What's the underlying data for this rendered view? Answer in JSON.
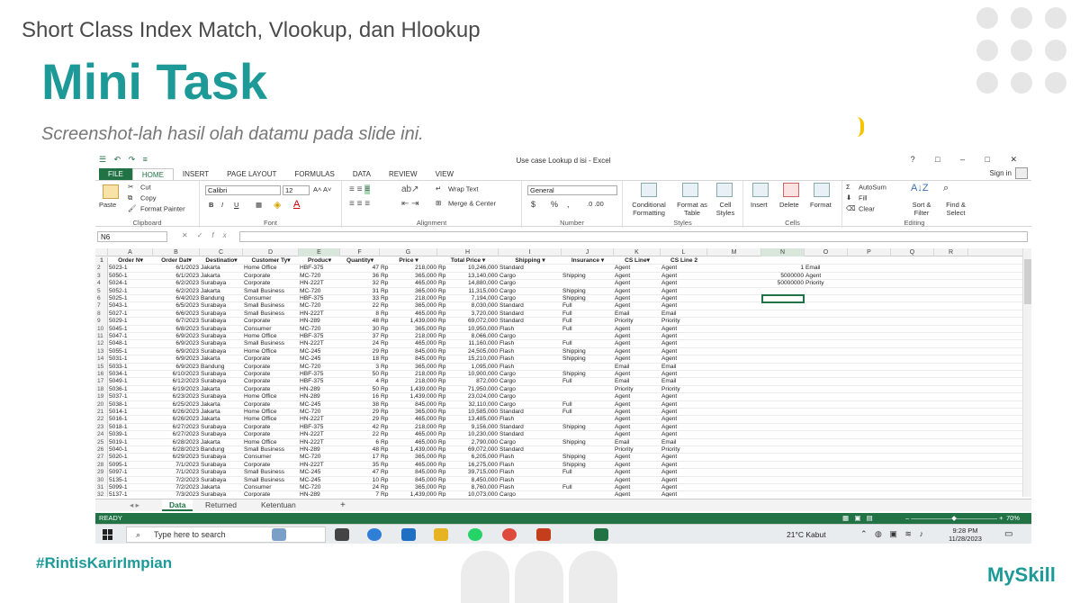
{
  "slide": {
    "title": "Short Class Index Match, Vlookup, dan Hlookup",
    "heading": "Mini Task",
    "subtitle": "Screenshot-lah hasil olah datamu pada slide ini.",
    "hashtag": "#RintisKarirImpian",
    "brand": "MySkill",
    "accent_color": "#1d9a98"
  },
  "excel": {
    "window_title": "Use case Lookup d isi - Excel",
    "quick_access": "☰ ↶ ↷ ≡",
    "window_controls": "? □ – □ ✕",
    "sign_in": "Sign in",
    "tabs": [
      "FILE",
      "HOME",
      "INSERT",
      "PAGE LAYOUT",
      "FORMULAS",
      "DATA",
      "REVIEW",
      "VIEW"
    ],
    "ribbon": {
      "clipboard": {
        "paste": "Paste",
        "cut": "Cut",
        "copy": "Copy",
        "format_painter": "Format Painter",
        "label": "Clipboard"
      },
      "font": {
        "name": "Calibri",
        "size": "12",
        "bold": "B",
        "italic": "I",
        "underline": "U",
        "label": "Font"
      },
      "alignment": {
        "wrap": "Wrap Text",
        "merge": "Merge & Center",
        "label": "Alignment"
      },
      "number": {
        "format": "General",
        "currency": "$",
        "percent": "%",
        "comma": ",",
        "label": "Number"
      },
      "styles": {
        "conditional": "Conditional Formatting",
        "format_table": "Format as Table",
        "cell_styles": "Cell Styles",
        "label": "Styles"
      },
      "cells": {
        "insert": "Insert",
        "delete": "Delete",
        "format": "Format",
        "label": "Cells"
      },
      "editing": {
        "autosum": "AutoSum",
        "fill": "Fill",
        "clear": "Clear",
        "sort": "Sort & Filter",
        "find": "Find & Select",
        "label": "Editing"
      }
    },
    "name_box": "N6",
    "fx": "fx",
    "columns": [
      "A",
      "B",
      "C",
      "D",
      "E",
      "F",
      "G",
      "H",
      "I",
      "J",
      "K",
      "L",
      "M",
      "N",
      "O",
      "P",
      "Q",
      "R"
    ],
    "headers": [
      "Order N▾",
      "Order Dat▾",
      "Destinatio▾",
      "Customer Ty▾",
      "Produc▾",
      "Quantity▾",
      "Price ▾",
      "Total Price ▾",
      "Shipping ▾",
      "Insurance ▾",
      "CS Line▾",
      "CS Line 2"
    ],
    "rows": [
      [
        "5023-1",
        "6/1/2023",
        "Jakarta",
        "Home Office",
        "HBF-375",
        "47",
        "218,000",
        "10,246,000",
        "Standard",
        "",
        "Agent",
        "Agent"
      ],
      [
        "5050-1",
        "6/1/2023",
        "Jakarta",
        "Corporate",
        "MC-720",
        "36",
        "365,000",
        "13,140,000",
        "Cargo",
        "Shipping",
        "Agent",
        "Agent"
      ],
      [
        "5024-1",
        "6/2/2023",
        "Surabaya",
        "Corporate",
        "HN-222T",
        "32",
        "465,000",
        "14,880,000",
        "Cargo",
        "",
        "Agent",
        "Agent"
      ],
      [
        "5052-1",
        "6/2/2023",
        "Jakarta",
        "Small Business",
        "MC-720",
        "31",
        "365,000",
        "11,315,000",
        "Cargo",
        "Shipping",
        "Agent",
        "Agent"
      ],
      [
        "5025-1",
        "6/4/2023",
        "Bandung",
        "Consumer",
        "HBF-375",
        "33",
        "218,000",
        "7,194,000",
        "Cargo",
        "Shipping",
        "Agent",
        "Agent"
      ],
      [
        "5043-1",
        "6/5/2023",
        "Surabaya",
        "Small Business",
        "MC-720",
        "22",
        "365,000",
        "8,030,000",
        "Standard",
        "Full",
        "Agent",
        "Agent"
      ],
      [
        "5027-1",
        "6/6/2023",
        "Surabaya",
        "Small Business",
        "HN-222T",
        "8",
        "465,000",
        "3,720,000",
        "Standard",
        "Full",
        "Email",
        "Email"
      ],
      [
        "5029-1",
        "6/7/2023",
        "Surabaya",
        "Corporate",
        "HN-289",
        "48",
        "1,439,000",
        "69,072,000",
        "Standard",
        "Full",
        "Priority",
        "Priority"
      ],
      [
        "5045-1",
        "6/8/2023",
        "Surabaya",
        "Consumer",
        "MC-720",
        "30",
        "365,000",
        "10,950,000",
        "Flash",
        "Full",
        "Agent",
        "Agent"
      ],
      [
        "5047-1",
        "6/9/2023",
        "Surabaya",
        "Home Office",
        "HBF-375",
        "37",
        "218,000",
        "8,066,000",
        "Cargo",
        "",
        "Agent",
        "Agent"
      ],
      [
        "5048-1",
        "6/9/2023",
        "Surabaya",
        "Small Business",
        "HN-222T",
        "24",
        "465,000",
        "11,160,000",
        "Flash",
        "Full",
        "Agent",
        "Agent"
      ],
      [
        "5055-1",
        "6/9/2023",
        "Surabaya",
        "Home Office",
        "MC-245",
        "29",
        "845,000",
        "24,505,000",
        "Flash",
        "Shipping",
        "Agent",
        "Agent"
      ],
      [
        "5031-1",
        "6/9/2023",
        "Jakarta",
        "Corporate",
        "MC-245",
        "18",
        "845,000",
        "15,210,000",
        "Flash",
        "Shipping",
        "Agent",
        "Agent"
      ],
      [
        "5033-1",
        "6/9/2023",
        "Bandung",
        "Corporate",
        "MC-720",
        "3",
        "365,000",
        "1,095,000",
        "Flash",
        "",
        "Email",
        "Email"
      ],
      [
        "5034-1",
        "6/10/2023",
        "Surabaya",
        "Corporate",
        "HBF-375",
        "50",
        "218,000",
        "10,900,000",
        "Cargo",
        "Shipping",
        "Agent",
        "Agent"
      ],
      [
        "5049-1",
        "6/12/2023",
        "Surabaya",
        "Corporate",
        "HBF-375",
        "4",
        "218,000",
        "872,000",
        "Cargo",
        "Full",
        "Email",
        "Email"
      ],
      [
        "5036-1",
        "6/19/2023",
        "Jakarta",
        "Corporate",
        "HN-289",
        "50",
        "1,439,000",
        "71,950,000",
        "Cargo",
        "",
        "Priority",
        "Priority"
      ],
      [
        "5037-1",
        "6/23/2023",
        "Surabaya",
        "Home Office",
        "HN-289",
        "16",
        "1,439,000",
        "23,024,000",
        "Cargo",
        "",
        "Agent",
        "Agent"
      ],
      [
        "5038-1",
        "6/25/2023",
        "Jakarta",
        "Corporate",
        "MC-245",
        "38",
        "845,000",
        "32,110,000",
        "Cargo",
        "Full",
        "Agent",
        "Agent"
      ],
      [
        "5014-1",
        "6/26/2023",
        "Jakarta",
        "Home Office",
        "MC-720",
        "29",
        "365,000",
        "10,585,000",
        "Standard",
        "Full",
        "Agent",
        "Agent"
      ],
      [
        "5016-1",
        "6/26/2023",
        "Jakarta",
        "Home Office",
        "HN-222T",
        "29",
        "465,000",
        "13,485,000",
        "Flash",
        "",
        "Agent",
        "Agent"
      ],
      [
        "5018-1",
        "6/27/2023",
        "Surabaya",
        "Corporate",
        "HBF-375",
        "42",
        "218,000",
        "9,156,000",
        "Standard",
        "Shipping",
        "Agent",
        "Agent"
      ],
      [
        "5039-1",
        "6/27/2023",
        "Surabaya",
        "Corporate",
        "HN-222T",
        "22",
        "465,000",
        "10,230,000",
        "Standard",
        "",
        "Agent",
        "Agent"
      ],
      [
        "5019-1",
        "6/28/2023",
        "Jakarta",
        "Home Office",
        "HN-222T",
        "6",
        "465,000",
        "2,790,000",
        "Cargo",
        "Shipping",
        "Email",
        "Email"
      ],
      [
        "5040-1",
        "6/28/2023",
        "Bandung",
        "Small Business",
        "HN-289",
        "48",
        "1,439,000",
        "69,072,000",
        "Standard",
        "",
        "Priority",
        "Priority"
      ],
      [
        "5020-1",
        "6/29/2023",
        "Surabaya",
        "Consumer",
        "MC-720",
        "17",
        "365,000",
        "6,205,000",
        "Flash",
        "Shipping",
        "Agent",
        "Agent"
      ],
      [
        "5095-1",
        "7/1/2023",
        "Surabaya",
        "Corporate",
        "HN-222T",
        "35",
        "465,000",
        "16,275,000",
        "Flash",
        "Shipping",
        "Agent",
        "Agent"
      ],
      [
        "5097-1",
        "7/1/2023",
        "Surabaya",
        "Small Business",
        "MC-245",
        "47",
        "845,000",
        "39,715,000",
        "Flash",
        "Full",
        "Agent",
        "Agent"
      ],
      [
        "5135-1",
        "7/2/2023",
        "Surabaya",
        "Small Business",
        "MC-245",
        "10",
        "845,000",
        "8,450,000",
        "Flash",
        "",
        "Agent",
        "Agent"
      ],
      [
        "5099-1",
        "7/2/2023",
        "Jakarta",
        "Consumer",
        "MC-720",
        "24",
        "365,000",
        "8,760,000",
        "Flash",
        "Full",
        "Agent",
        "Agent"
      ],
      [
        "5137-1",
        "7/3/2023",
        "Surabaya",
        "Corporate",
        "HN-289",
        "7",
        "1,439,000",
        "10,073,000",
        "Cargo",
        "",
        "Agent",
        "Agent"
      ]
    ],
    "currency": "Rp",
    "lookup": [
      {
        "n": "1",
        "o": "Email"
      },
      {
        "n": "5000000",
        "o": "Agent"
      },
      {
        "n": "50000000",
        "o": "Priority"
      }
    ],
    "sheets": [
      "Data",
      "Returned",
      "Ketentuan"
    ],
    "add_sheet": "+",
    "status": "READY",
    "zoom": "70%"
  },
  "taskbar": {
    "search_placeholder": "Type here to search",
    "weather": "21°C  Kabut",
    "time": "9:28 PM",
    "date": "11/28/2023"
  }
}
